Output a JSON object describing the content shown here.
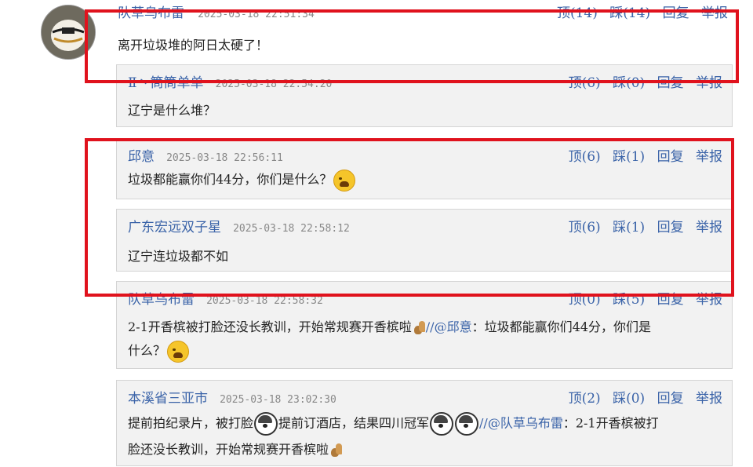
{
  "main_comment": {
    "user": "队草乌布雷",
    "time": "2025-03-18 22:51:34",
    "up": "顶(14)",
    "down": "踩(14)",
    "reply": "回复",
    "report": "举报",
    "text": "离开垃圾堆的阿日太硬了！"
  },
  "replies": [
    {
      "user": "Ⅱ丶筒筒单单",
      "time": "2025-03-18 22:54:20",
      "up": "顶(6)",
      "down": "踩(0)",
      "reply": "回复",
      "report": "举报",
      "text": "辽宁是什么堆？"
    },
    {
      "user": "邱意",
      "time": "2025-03-18 22:56:11",
      "up": "顶(6)",
      "down": "踩(1)",
      "reply": "回复",
      "report": "举报",
      "text": "垃圾都能赢你们44分，你们是什么？"
    },
    {
      "user": "广东宏远双子星",
      "time": "2025-03-18 22:58:12",
      "up": "顶(6)",
      "down": "踩(1)",
      "reply": "回复",
      "report": "举报",
      "text": "辽宁连垃圾都不如"
    },
    {
      "user": "队草乌布雷",
      "time": "2025-03-18 22:58:32",
      "up": "顶(0)",
      "down": "踩(5)",
      "reply": "回复",
      "report": "举报",
      "text_part1": "2-1开香槟被打脸还没长教训，开始常规赛开香槟啦",
      "mention": "//@邱意",
      "text_part2": "：垃圾都能赢你们44分，你们是",
      "text_line2": "什么？"
    },
    {
      "user": "本溪省三亚市",
      "time": "2025-03-18 23:02:30",
      "up": "顶(2)",
      "down": "踩(0)",
      "reply": "回复",
      "report": "举报",
      "text_a": "提前拍纪录片，被打脸",
      "text_b": "提前订酒店，结果四川冠军",
      "mention": "//@队草乌布雷",
      "text_c": "：2-1开香槟被打",
      "text_line2": "脸还没长教训，开始常规赛开香槟啦"
    }
  ],
  "colors": {
    "link": "#3a63a8",
    "annotation": "#e0121d",
    "reply_bg": "#f2f2f2"
  },
  "icons": [
    "avatar-basketball",
    "sad-face-emoji",
    "dog-emoji",
    "squirrel-emoji"
  ]
}
